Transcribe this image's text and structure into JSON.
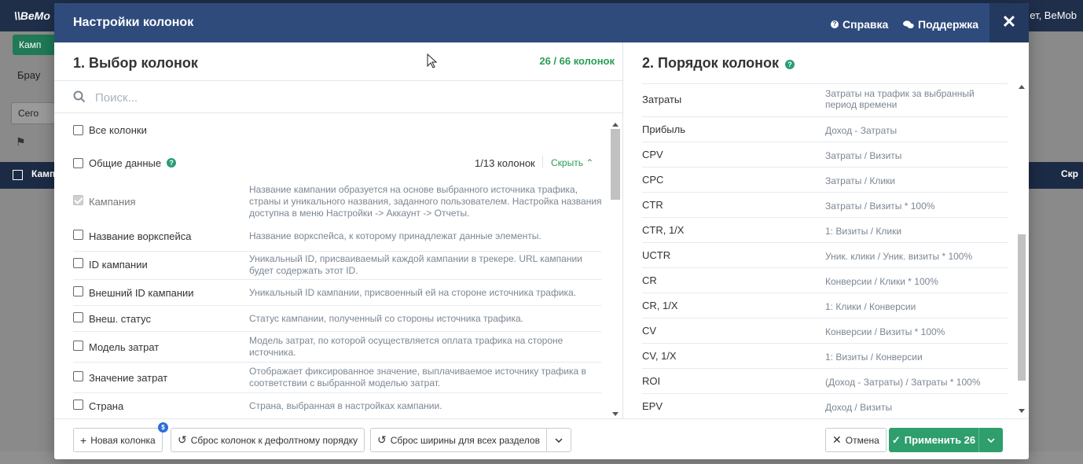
{
  "background": {
    "logo": "\\\\BeMo",
    "user_text": "ет, BeMob",
    "tab_label": "Камп",
    "nav_label": "Брау",
    "date_button": "Сего",
    "table_header_left": "Кампа",
    "table_header_right": "Скр"
  },
  "modal": {
    "title": "Настройки колонок",
    "help_label": "Справка",
    "support_label": "Поддержка",
    "close_label": "✕"
  },
  "left": {
    "title": "1. Выбор колонок",
    "count": "26 / 66 колонок",
    "search_placeholder": "Поиск...",
    "all_columns_label": "Все колонки",
    "group": {
      "label": "Общие данные",
      "count": "1/13 колонок",
      "hide_label": "Скрыть"
    },
    "columns": [
      {
        "name": "Кампания",
        "checked": true,
        "desc": "Название кампании образуется на основе выбранного источника трафика, страны и уникального названия, заданного пользователем. Настройка названия доступна в меню Настройки -> Аккаунт -> Отчеты."
      },
      {
        "name": "Название воркспейса",
        "checked": false,
        "desc": "Название воркспейса, к которому принадлежат данные элементы."
      },
      {
        "name": "ID кампании",
        "checked": false,
        "desc": "Уникальный ID, присваиваемый каждой кампании в трекере. URL кампании будет содержать этот ID."
      },
      {
        "name": "Внешний ID кампании",
        "checked": false,
        "desc": "Уникальный ID кампании, присвоенный ей на стороне источника трафика."
      },
      {
        "name": "Внеш. статус",
        "checked": false,
        "desc": "Статус кампании, полученный со стороны источника трафика."
      },
      {
        "name": "Модель затрат",
        "checked": false,
        "desc": "Модель затрат, по которой осуществляется оплата трафика на стороне источника."
      },
      {
        "name": "Значение затрат",
        "checked": false,
        "desc": "Отображает фиксированное значение, выплачиваемое источнику трафика в соответствии с выбранной моделью затрат."
      },
      {
        "name": "Страна",
        "checked": false,
        "desc": "Страна, выбранная в настройках кампании."
      }
    ]
  },
  "right": {
    "title": "2. Порядок колонок",
    "items": [
      {
        "name": "Затраты",
        "formula": "Затраты на трафик за выбранный период времени"
      },
      {
        "name": "Прибыль",
        "formula": "Доход - Затраты"
      },
      {
        "name": "CPV",
        "formula": "Затраты / Визиты"
      },
      {
        "name": "CPC",
        "formula": "Затраты / Клики"
      },
      {
        "name": "CTR",
        "formula": "Затраты / Визиты * 100%"
      },
      {
        "name": "CTR, 1/X",
        "formula": "1: Визиты / Клики"
      },
      {
        "name": "UCTR",
        "formula": "Уник. клики / Уник. визиты * 100%"
      },
      {
        "name": "CR",
        "formula": "Конверсии / Клики * 100%"
      },
      {
        "name": "CR, 1/X",
        "formula": "1: Клики / Конверсии"
      },
      {
        "name": "CV",
        "formula": "Конверсии / Визиты * 100%"
      },
      {
        "name": "CV, 1/X",
        "formula": "1: Визиты / Конверсии"
      },
      {
        "name": "ROI",
        "formula": "(Доход - Затраты) / Затраты * 100%"
      },
      {
        "name": "EPV",
        "formula": "Доход / Визиты"
      }
    ]
  },
  "footer": {
    "new_column": "Новая колонка",
    "new_column_badge": "$",
    "reset_order": "Сброс колонок к дефолтному порядку",
    "reset_width": "Сброс ширины для всех разделов",
    "cancel": "Отмена",
    "apply": "Применить 26"
  },
  "colors": {
    "header": "#2e4b7c",
    "accent_green": "#2e9e6c",
    "count_green": "#2a9d56"
  }
}
